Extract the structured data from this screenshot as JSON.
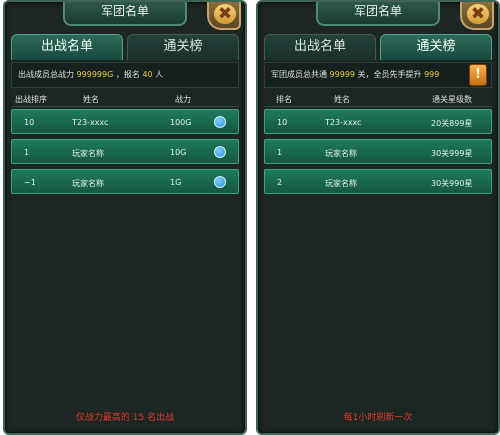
{
  "left": {
    "title": "军团名单",
    "tabs": [
      "出战名单",
      "通关榜"
    ],
    "info": {
      "prefix": "出战成员总战力",
      "power": "999999G",
      "middle": "，报名",
      "count": "40",
      "suffix": "人"
    },
    "columns": [
      "出战排序",
      "姓名",
      "战力"
    ],
    "rows": [
      {
        "rank": "10",
        "name": "T23-xxxc",
        "power": "100G"
      },
      {
        "rank": "1",
        "name": "玩家名称",
        "power": "10G"
      },
      {
        "rank": "~1",
        "name": "玩家名称",
        "power": "1G"
      }
    ],
    "footer": "仅战力最高的 15 名出战"
  },
  "right": {
    "title": "军团名单",
    "tabs": [
      "出战名单",
      "通关榜"
    ],
    "info": {
      "prefix": "军团成员总共通",
      "levels": "99999",
      "middle": "关，全员先手提升",
      "boost": "999"
    },
    "info_icon": "!",
    "columns": [
      "排名",
      "姓名",
      "通关星级数"
    ],
    "rows": [
      {
        "rank": "10",
        "name": "T23-xxxc",
        "stars": "20关899星"
      },
      {
        "rank": "1",
        "name": "玩家名称",
        "stars": "30关999星"
      },
      {
        "rank": "2",
        "name": "玩家名称",
        "stars": "30关990星"
      }
    ],
    "footer": "每1小时刷新一次"
  },
  "close_glyph": "✖",
  "colors": {
    "panel_bg": "#1c2623",
    "row_bg": "#1f7a5c",
    "highlight": "#e8d040",
    "footer_text": "#e0352f"
  }
}
